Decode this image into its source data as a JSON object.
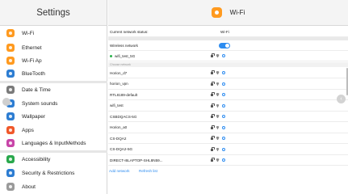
{
  "left": {
    "title": "Settings",
    "items": [
      {
        "label": "Wi-Fi",
        "color": "#ff9a1f",
        "icon": "wifi-icon"
      },
      {
        "label": "Ethernet",
        "color": "#ff9a1f",
        "icon": "ethernet-icon"
      },
      {
        "label": "Wi-Fi Ap",
        "color": "#ff9a1f",
        "icon": "hotspot-icon"
      },
      {
        "label": "BlueTooth",
        "color": "#2d7dd2",
        "icon": "bluetooth-icon"
      },
      {
        "label": "Date & Time",
        "color": "#7a7a7a",
        "icon": "clock-icon"
      },
      {
        "label": "System sounds",
        "color": "#2d7dd2",
        "icon": "sound-icon"
      },
      {
        "label": "Wallpaper",
        "color": "#2d7dd2",
        "icon": "wallpaper-icon"
      },
      {
        "label": "Apps",
        "color": "#f0582a",
        "icon": "apps-icon"
      },
      {
        "label": "Languages & InputMethods",
        "color": "#c845a8",
        "icon": "language-icon"
      },
      {
        "label": "Accessibility",
        "color": "#29a84c",
        "icon": "accessibility-icon"
      },
      {
        "label": "Security & Restrictions",
        "color": "#2d7dd2",
        "icon": "lock-icon"
      },
      {
        "label": "About",
        "color": "#9a9a9a",
        "icon": "info-icon"
      }
    ]
  },
  "right": {
    "title": "Wi-Fi",
    "status_label": "Current network status:",
    "status_value": "Wi-Fi",
    "wireless_label": "Wireless network",
    "connected_network": "wifi_test_5G",
    "section_label": "Choose network",
    "networks": [
      "Horion_d7",
      "horion_vpn",
      "RTL8189-default",
      "wifi_test",
      "CSBDQACS-5G",
      "Horion_a0",
      "CS-DQA2",
      "CS-DQA2-5G",
      "DIRECT-I6LAPTOP-SHL8N59..."
    ],
    "add_network": "Add network",
    "refresh_list": "Refresh list"
  }
}
